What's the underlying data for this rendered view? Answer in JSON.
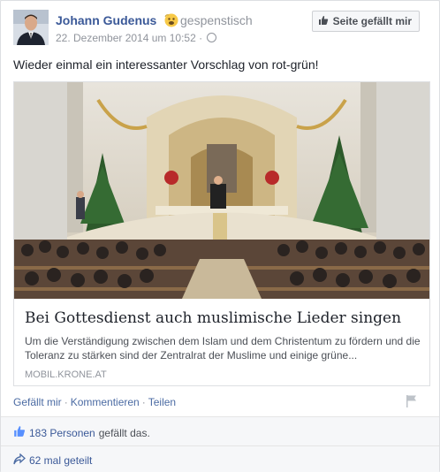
{
  "post": {
    "author": "Johann Gudenus",
    "feeling": "gespenstisch",
    "timestamp": "22. Dezember 2014 um 10:52",
    "like_page_button": "Seite gefällt mir",
    "text": "Wieder einmal ein interessanter Vorschlag von rot-grün!"
  },
  "link": {
    "title": "Bei Gottesdienst auch muslimische Lieder singen",
    "description": "Um die Verständigung zwischen dem Islam und dem Christentum zu fördern und die Toleranz zu stärken sind der Zentralrat der Muslime und einige grüne...",
    "domain": "MOBIL.KRONE.AT"
  },
  "actions": {
    "like": "Gefällt mir",
    "comment": "Kommentieren",
    "share": "Teilen",
    "separator": "·"
  },
  "summary": {
    "likes_count": "183 Personen",
    "likes_text": "gefällt das.",
    "shares": "62 mal geteilt"
  },
  "icons": {
    "like_page": "thumbs-up-icon",
    "feeling": "ghost-emoji-icon",
    "privacy": "globe-icon",
    "report": "flag-icon",
    "likes": "thumbs-up-icon",
    "shares": "share-arrow-icon"
  },
  "colors": {
    "link_blue": "#3b5998",
    "meta_gray": "#90949c"
  }
}
